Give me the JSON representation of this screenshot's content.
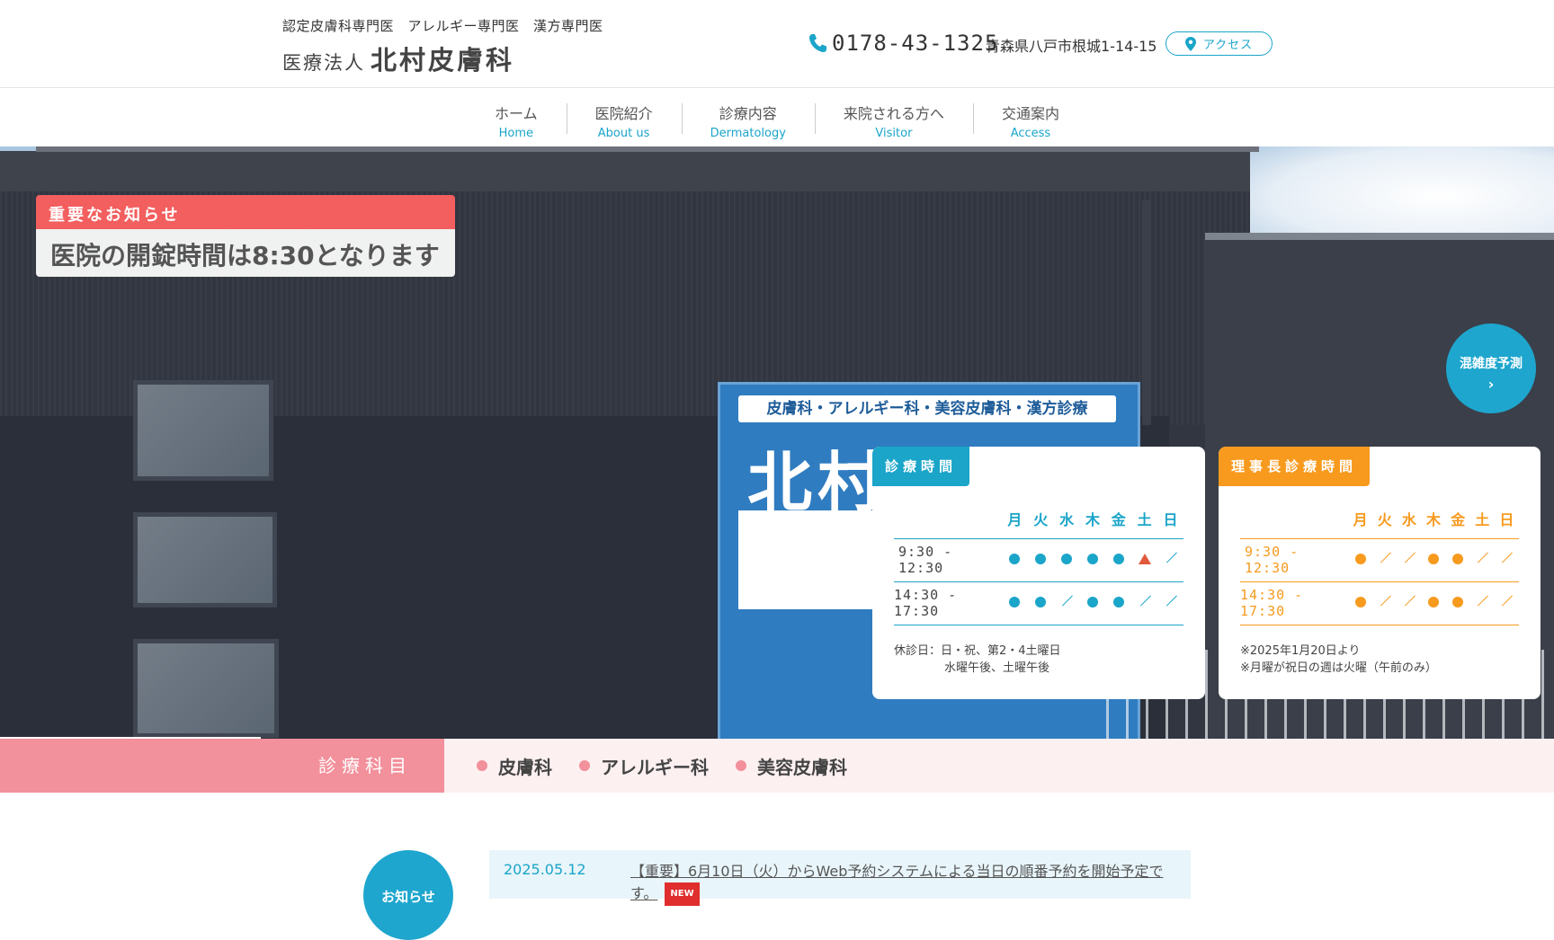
{
  "header": {
    "specialties": "認定皮膚科専門医　アレルギー専門医　漢方専門医",
    "logo_prefix": "医療法人",
    "logo_name": "北村皮膚科",
    "phone_icon": "phone-icon",
    "phone": "0178-43-1325",
    "address": "青森県八戸市根城1-14-15",
    "access_icon": "map-pin-icon",
    "access_label": "アクセス"
  },
  "nav": {
    "items": [
      {
        "jp": "ホーム",
        "en": "Home"
      },
      {
        "jp": "医院紹介",
        "en": "About us"
      },
      {
        "jp": "診療内容",
        "en": "Dermatology"
      },
      {
        "jp": "来院される方へ",
        "en": "Visitor"
      },
      {
        "jp": "交通案内",
        "en": "Access"
      }
    ]
  },
  "hero": {
    "sign_top": "皮膚科・アレルギー科・美容皮膚科・漢方診療",
    "sign_name": "北村皮膚科"
  },
  "notice": {
    "heading": "重要なお知らせ",
    "message": "医院の開錠時間は8:30となります"
  },
  "congestion": {
    "label": "混雑度予測",
    "chevron": "›"
  },
  "schedule": {
    "title": "診療時間",
    "days": [
      "月",
      "火",
      "水",
      "木",
      "金",
      "土",
      "日"
    ],
    "rows": [
      {
        "time": "9:30 - 12:30",
        "marks": [
          "dot",
          "dot",
          "dot",
          "dot",
          "dot",
          "triangle",
          "slash"
        ]
      },
      {
        "time": "14:30 - 17:30",
        "marks": [
          "dot",
          "dot",
          "slash",
          "dot",
          "dot",
          "slash",
          "slash"
        ]
      }
    ],
    "note_line1": "休診日：日・祝、第2・4土曜日",
    "note_line2": "水曜午後、土曜午後"
  },
  "director_schedule": {
    "title": "理事長診療時間",
    "days": [
      "月",
      "火",
      "水",
      "木",
      "金",
      "土",
      "日"
    ],
    "rows": [
      {
        "time": "9:30 - 12:30",
        "marks": [
          "dot",
          "slash",
          "slash",
          "dot",
          "dot",
          "slash",
          "slash"
        ]
      },
      {
        "time": "14:30 - 17:30",
        "marks": [
          "dot",
          "slash",
          "slash",
          "dot",
          "dot",
          "slash",
          "slash"
        ]
      }
    ],
    "note_line1": "※2025年1月20日より",
    "note_line2": "※月曜が祝日の週は火曜（午前のみ）"
  },
  "departments": {
    "label": "診療科目",
    "items": [
      "皮膚科",
      "アレルギー科",
      "美容皮膚科"
    ]
  },
  "news": {
    "label": "お知らせ",
    "items": [
      {
        "date": "2025.05.12",
        "title": "【重要】6月10日（火）からWeb予約システムによる当日の順番予約を開始予定です。",
        "badge": "NEW"
      }
    ]
  },
  "colors": {
    "accent_blue": "#1aa5c9",
    "accent_orange": "#f79a1e",
    "notice_red": "#f35e5e",
    "dept_pink": "#f2909b"
  }
}
